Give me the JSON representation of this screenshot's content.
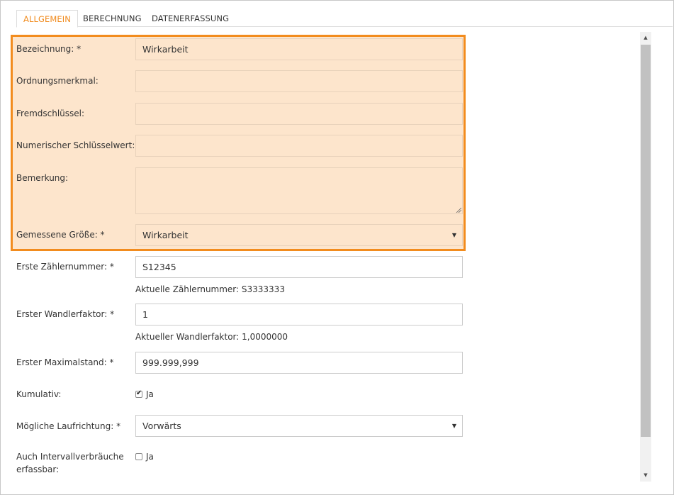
{
  "tabs": [
    {
      "label": "ALLGEMEIN",
      "active": true
    },
    {
      "label": "BERECHNUNG",
      "active": false
    },
    {
      "label": "DATENERFASSUNG",
      "active": false
    }
  ],
  "form": {
    "bezeichnung": {
      "label": "Bezeichnung: *",
      "value": "Wirkarbeit"
    },
    "ordnungsmerkmal": {
      "label": "Ordnungsmerkmal:",
      "value": ""
    },
    "fremdschluessel": {
      "label": "Fremdschlüssel:",
      "value": ""
    },
    "numerischer_schluesselwert": {
      "label": "Numerischer Schlüsselwert:",
      "value": ""
    },
    "bemerkung": {
      "label": "Bemerkung:",
      "value": ""
    },
    "gemessene_groesse": {
      "label": "Gemessene Größe: *",
      "value": "Wirkarbeit"
    },
    "erste_zaehlernummer": {
      "label": "Erste Zählernummer: *",
      "value": "S12345",
      "hint": "Aktuelle Zählernummer: S3333333"
    },
    "erster_wandlerfaktor": {
      "label": "Erster Wandlerfaktor: *",
      "value": "1",
      "hint": "Aktueller Wandlerfaktor: 1,0000000"
    },
    "erster_maximalstand": {
      "label": "Erster Maximalstand: *",
      "value": "999.999,999"
    },
    "kumulativ": {
      "label": "Kumulativ:",
      "checked": true,
      "option_label": "Ja"
    },
    "moegliche_laufrichtung": {
      "label": "Mögliche Laufrichtung: *",
      "value": "Vorwärts"
    },
    "intervallverbraeuche": {
      "label_line1": "Auch Intervallverbräuche",
      "label_line2": "erfassbar:",
      "checked": false,
      "option_label": "Ja"
    }
  },
  "colors": {
    "accent": "#f08a1c",
    "highlight_border": "#f28c1e",
    "highlight_fill": "#fde5cc"
  },
  "icons": {
    "select_arrow": "caret-down-icon",
    "scroll_up": "scroll-up-arrow-icon",
    "scroll_down": "scroll-down-arrow-icon",
    "check": "checkmark-icon"
  }
}
